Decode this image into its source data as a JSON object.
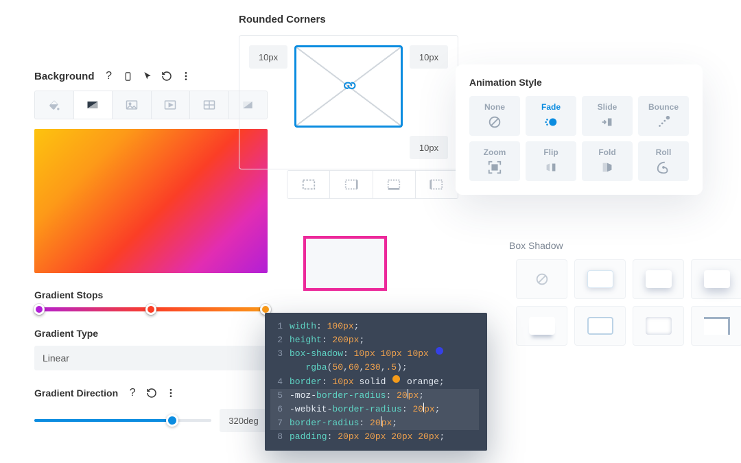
{
  "background": {
    "title": "Background",
    "gradient_stops_label": "Gradient Stops",
    "gradient_type_label": "Gradient Type",
    "gradient_type_value": "Linear",
    "gradient_direction_label": "Gradient Direction",
    "gradient_direction_value": "320deg",
    "stops": [
      {
        "color": "#b21fd6",
        "pos": 0
      },
      {
        "color": "#fb3e26",
        "pos": 50
      },
      {
        "color": "#fd9a18",
        "pos": 100
      }
    ]
  },
  "corners": {
    "title": "Rounded Corners",
    "tl": "10px",
    "tr": "10px",
    "br": "10px"
  },
  "animation": {
    "title": "Animation Style",
    "options": [
      "None",
      "Fade",
      "Slide",
      "Bounce",
      "Zoom",
      "Flip",
      "Fold",
      "Roll"
    ],
    "active": "Fade"
  },
  "box_shadow": {
    "title": "Box Shadow"
  },
  "code": {
    "lines": [
      {
        "n": 1,
        "parts": [
          [
            "prop",
            "width"
          ],
          [
            "punc",
            ": "
          ],
          [
            "num",
            "100px"
          ],
          [
            "punc",
            ";"
          ]
        ]
      },
      {
        "n": 2,
        "parts": [
          [
            "prop",
            "height"
          ],
          [
            "punc",
            ": "
          ],
          [
            "num",
            "200px"
          ],
          [
            "punc",
            ";"
          ]
        ]
      },
      {
        "n": 3,
        "parts": [
          [
            "prop",
            "box-shadow"
          ],
          [
            "punc",
            ": "
          ],
          [
            "num",
            "10px 10px 10px "
          ],
          [
            "swatch",
            "blue"
          ]
        ]
      },
      {
        "n": 0,
        "indent": true,
        "parts": [
          [
            "prop",
            "rgba"
          ],
          [
            "punc",
            "("
          ],
          [
            "num",
            "50"
          ],
          [
            "punc",
            ","
          ],
          [
            "num",
            "60"
          ],
          [
            "punc",
            ","
          ],
          [
            "num",
            "230"
          ],
          [
            "punc",
            ","
          ],
          [
            "num",
            ".5"
          ],
          [
            "punc",
            ")"
          ],
          [
            "punc",
            ";"
          ]
        ]
      },
      {
        "n": 4,
        "parts": [
          [
            "prop",
            "border"
          ],
          [
            "punc",
            ": "
          ],
          [
            "num",
            "10px "
          ],
          [
            "kw",
            "solid "
          ],
          [
            "swatch",
            "orange"
          ],
          [
            "kw",
            " orange"
          ],
          [
            "punc",
            ";"
          ]
        ]
      },
      {
        "n": 5,
        "hl": true,
        "parts": [
          [
            "vend",
            "-moz-"
          ],
          [
            "prop",
            "border-radius"
          ],
          [
            "punc",
            ": "
          ],
          [
            "num",
            "20"
          ],
          [
            "caret",
            ""
          ],
          [
            "num",
            "px"
          ],
          [
            "punc",
            ";"
          ]
        ]
      },
      {
        "n": 6,
        "hl": true,
        "parts": [
          [
            "vend",
            "-webkit-"
          ],
          [
            "prop",
            "border-radius"
          ],
          [
            "punc",
            ": "
          ],
          [
            "num",
            "20"
          ],
          [
            "caret",
            ""
          ],
          [
            "num",
            "px"
          ],
          [
            "punc",
            ";"
          ]
        ]
      },
      {
        "n": 7,
        "hl": true,
        "parts": [
          [
            "prop",
            "border-radius"
          ],
          [
            "punc",
            ": "
          ],
          [
            "num",
            "20"
          ],
          [
            "caret",
            ""
          ],
          [
            "num",
            "px"
          ],
          [
            "punc",
            ";"
          ]
        ]
      },
      {
        "n": 8,
        "parts": [
          [
            "prop",
            "padding"
          ],
          [
            "punc",
            ": "
          ],
          [
            "num",
            "20px 20px 20px 20px"
          ],
          [
            "punc",
            ";"
          ]
        ]
      }
    ]
  }
}
